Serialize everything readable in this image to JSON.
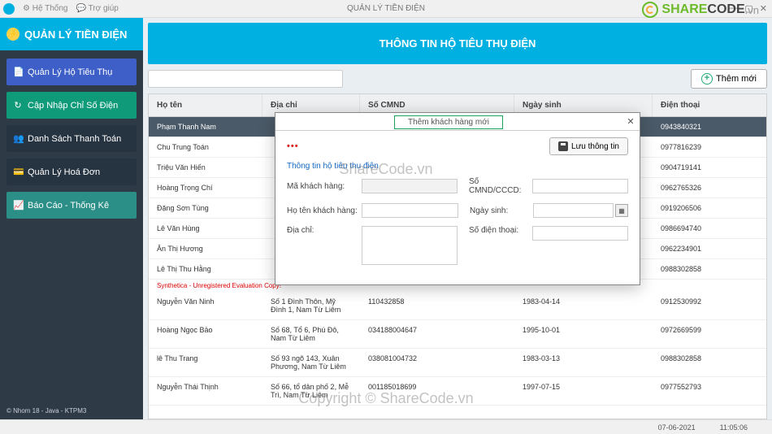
{
  "titlebar": {
    "title": "QUẢN LÝ TIỀN ĐIỆN",
    "menu1": "Hệ Thống",
    "menu2": "Trợ giúp"
  },
  "brand": "QUẢN LÝ TIỀN ĐIỆN",
  "sidebar": {
    "items": [
      {
        "label": "Quản Lý Hộ Tiêu Thụ",
        "icon": "📄"
      },
      {
        "label": "Cập Nhập Chỉ Số Điện",
        "icon": "↻"
      },
      {
        "label": "Danh Sách Thanh Toán",
        "icon": "👥"
      },
      {
        "label": "Quản Lý Hoá Đơn",
        "icon": "💳"
      },
      {
        "label": "Báo Cáo - Thống Kê",
        "icon": "📈"
      }
    ],
    "footer": "© Nhom 18 - Java - KTPM3"
  },
  "header": "THÔNG TIN HỘ TIÊU THỤ ĐIỆN",
  "add_button": "Thêm mới",
  "columns": {
    "name": "Họ tên",
    "addr": "Địa chỉ",
    "cmnd": "Số CMND",
    "dob": "Ngày sinh",
    "phone": "Điện thoại"
  },
  "rows": [
    {
      "name": "Phạm Thanh Nam",
      "addr": "",
      "cmnd": "",
      "dob": "",
      "phone": "0943840321",
      "sel": true
    },
    {
      "name": "Chu Trung Toán",
      "addr": "",
      "cmnd": "",
      "dob": "",
      "phone": "0977816239"
    },
    {
      "name": "Triệu Văn Hiến",
      "addr": "",
      "cmnd": "",
      "dob": "",
      "phone": "0904719141"
    },
    {
      "name": "Hoàng Trọng Chí",
      "addr": "",
      "cmnd": "",
      "dob": "",
      "phone": "0962765326"
    },
    {
      "name": "Đặng Sơn Tùng",
      "addr": "",
      "cmnd": "",
      "dob": "",
      "phone": "0919206506"
    },
    {
      "name": "Lê Văn Hùng",
      "addr": "",
      "cmnd": "",
      "dob": "",
      "phone": "0986694740"
    },
    {
      "name": "Ân Thị Hương",
      "addr": "",
      "cmnd": "",
      "dob": "",
      "phone": "0962234901"
    },
    {
      "name": "Lê Thị Thu Hằng",
      "addr": "",
      "cmnd": "",
      "dob": "",
      "phone": "0988302858"
    },
    {
      "name": "Nguyễn Văn Ninh",
      "addr": "Số 1 Đình Thôn, Mỹ Đình 1, Nam Từ Liêm",
      "cmnd": "110432858",
      "dob": "1983-04-14",
      "phone": "0912530992"
    },
    {
      "name": "Hoàng Ngọc Bảo",
      "addr": "Số 68, Tổ 6, Phú Đô, Nam Từ Liêm",
      "cmnd": "034188004647",
      "dob": "1995-10-01",
      "phone": "0972669599"
    },
    {
      "name": "lê Thu Trang",
      "addr": "Số 93 ngõ 143, Xuân Phương, Nam Từ Liêm",
      "cmnd": "038081004732",
      "dob": "1983-03-13",
      "phone": "0988302858"
    },
    {
      "name": "Nguyễn Thái Thịnh",
      "addr": "Số 66, tổ dân phố 2, Mễ Trì, Nam Từ Liêm",
      "cmnd": "001185018699",
      "dob": "1997-07-15",
      "phone": "0977552793"
    }
  ],
  "eval_note": "Synthetica - Unregistered Evaluation Copy!",
  "dialog": {
    "title": "Thêm khách hàng mới",
    "save": "Lưu thông tin",
    "section": "Thông tin hộ tiêu thụ điện",
    "f_makh": "Mã khách hàng:",
    "f_cmnd": "Số CMND/CCCD:",
    "f_hoten": "Họ tên khách hàng:",
    "f_ngaysinh": "Ngày sinh:",
    "f_diachi": "Địa chỉ:",
    "f_sdt": "Số điện thoại:"
  },
  "status": {
    "date": "07-06-2021",
    "time": "11:05:06"
  },
  "watermark": {
    "brand1": "SHARE",
    "brand2": "CODE",
    "suffix": ".vn",
    "center1": "ShareCode.vn",
    "center2": "Copyright © ShareCode.vn"
  }
}
